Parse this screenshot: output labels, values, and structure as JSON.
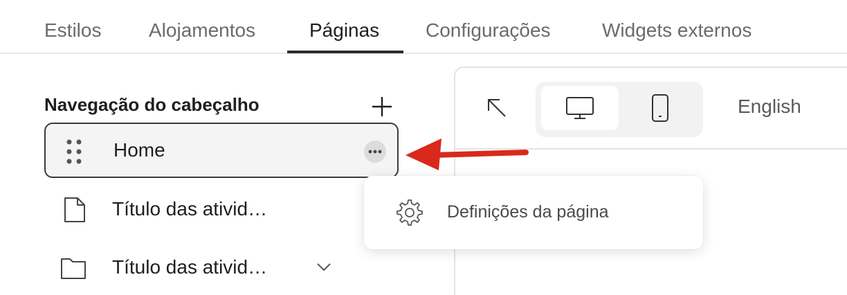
{
  "tabs": [
    {
      "label": "Estilos",
      "active": false
    },
    {
      "label": "Alojamentos",
      "active": false
    },
    {
      "label": "Páginas",
      "active": true
    },
    {
      "label": "Configurações",
      "active": false
    },
    {
      "label": "Widgets externos",
      "active": false
    }
  ],
  "sidebar": {
    "section_title": "Navegação do cabeçalho",
    "add_icon": "plus-icon",
    "items": [
      {
        "label": "Home",
        "icon": "drag-handle-icon",
        "selected": true,
        "more_icon": "more-horizontal-icon"
      },
      {
        "label": "Título das ativid…",
        "icon": "file-icon",
        "selected": false
      },
      {
        "label": "Título das ativid…",
        "icon": "folder-icon",
        "selected": false,
        "expand_icon": "chevron-down-icon"
      }
    ]
  },
  "preview": {
    "expand_icon": "arrow-up-left-icon",
    "devices": [
      {
        "name": "desktop",
        "icon": "desktop-icon",
        "selected": true
      },
      {
        "name": "mobile",
        "icon": "mobile-icon",
        "selected": false
      }
    ],
    "language": "English"
  },
  "context_menu": {
    "items": [
      {
        "label": "Definições da página",
        "icon": "gear-icon"
      }
    ]
  },
  "annotation": {
    "type": "arrow",
    "color": "#d9291c"
  },
  "colors": {
    "active_tab_underline": "#2b2b2b",
    "selected_border": "#3a3a3a"
  }
}
